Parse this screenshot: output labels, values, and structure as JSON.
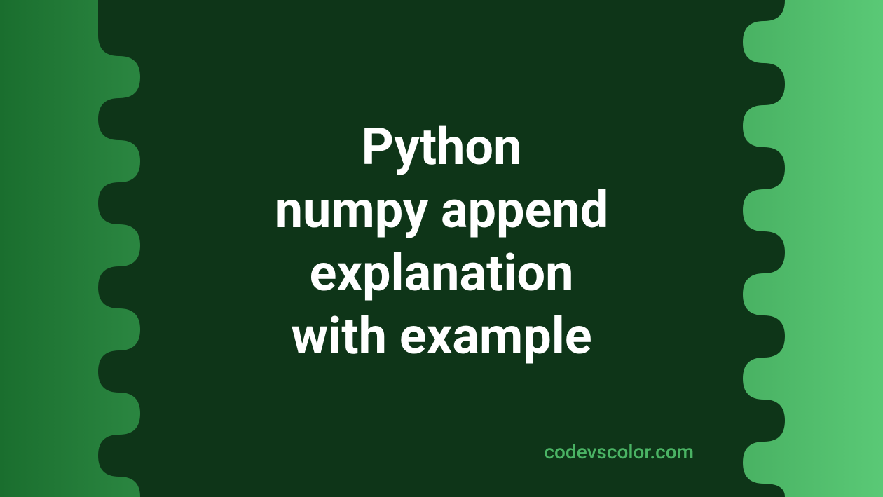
{
  "title": {
    "line1": "Python",
    "line2": "numpy append",
    "line3": "explanation",
    "line4": "with example"
  },
  "watermark": "codevscolor.com",
  "colors": {
    "text": "#ffffff",
    "watermark": "#4ab364",
    "blob": "#0e3518",
    "gradient_start": "#1a6e2e",
    "gradient_end": "#5ac976"
  }
}
